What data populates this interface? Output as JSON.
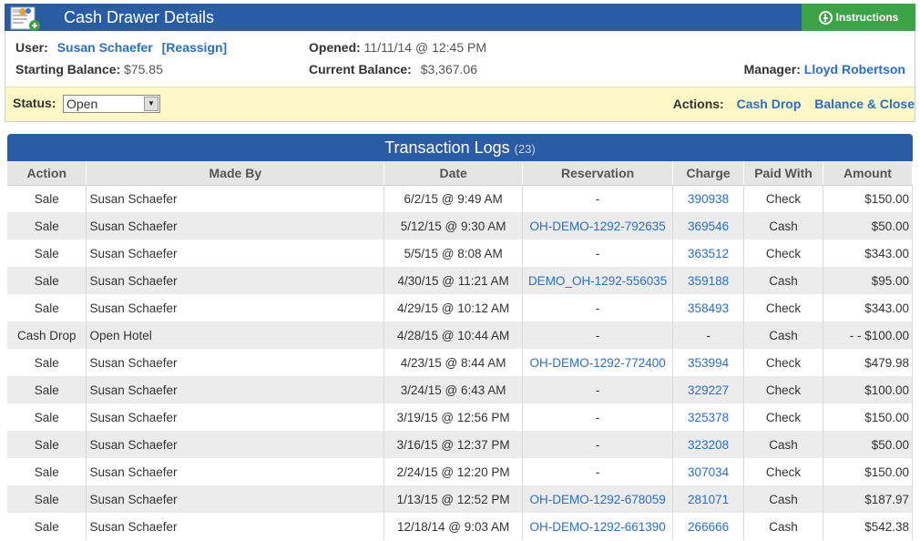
{
  "header": {
    "title": "Cash Drawer Details",
    "instructions_label": "Instructions"
  },
  "info": {
    "user_label": "User:",
    "user_name": "Susan Schaefer",
    "reassign_label": "[Reassign]",
    "opened_label": "Opened:",
    "opened_value": "11/11/14 @ 12:45 PM",
    "starting_balance_label": "Starting Balance:",
    "starting_balance_value": "$75.85",
    "current_balance_label": "Current Balance:",
    "current_balance_value": "$3,367.06",
    "manager_label": "Manager:",
    "manager_name": "Lloyd Robertson"
  },
  "status": {
    "label": "Status:",
    "selected": "Open",
    "actions_label": "Actions:",
    "cash_drop_label": "Cash Drop",
    "balance_close_label": "Balance & Close"
  },
  "transactions": {
    "title": "Transaction Logs",
    "count": "(23)",
    "columns": [
      "Action",
      "Made By",
      "Date",
      "Reservation",
      "Charge",
      "Paid With",
      "Amount"
    ],
    "rows": [
      {
        "action": "Sale",
        "made_by": "Susan Schaefer",
        "date": "6/2/15 @ 9:49 AM",
        "reservation": "-",
        "charge": "390938",
        "paid_with": "Check",
        "amount": "$150.00"
      },
      {
        "action": "Sale",
        "made_by": "Susan Schaefer",
        "date": "5/12/15 @ 9:30 AM",
        "reservation": "OH-DEMO-1292-792635",
        "charge": "369546",
        "paid_with": "Cash",
        "amount": "$50.00"
      },
      {
        "action": "Sale",
        "made_by": "Susan Schaefer",
        "date": "5/5/15 @ 8:08 AM",
        "reservation": "-",
        "charge": "363512",
        "paid_with": "Check",
        "amount": "$343.00"
      },
      {
        "action": "Sale",
        "made_by": "Susan Schaefer",
        "date": "4/30/15 @ 11:21 AM",
        "reservation": "DEMO_OH-1292-556035",
        "charge": "359188",
        "paid_with": "Cash",
        "amount": "$95.00"
      },
      {
        "action": "Sale",
        "made_by": "Susan Schaefer",
        "date": "4/29/15 @ 10:12 AM",
        "reservation": "-",
        "charge": "358493",
        "paid_with": "Check",
        "amount": "$343.00"
      },
      {
        "action": "Cash Drop",
        "made_by": "Open Hotel",
        "date": "4/28/15 @ 10:44 AM",
        "reservation": "-",
        "charge": "-",
        "paid_with": "Cash",
        "amount": "- - $100.00"
      },
      {
        "action": "Sale",
        "made_by": "Susan Schaefer",
        "date": "4/23/15 @ 8:44 AM",
        "reservation": "OH-DEMO-1292-772400",
        "charge": "353994",
        "paid_with": "Check",
        "amount": "$479.98"
      },
      {
        "action": "Sale",
        "made_by": "Susan Schaefer",
        "date": "3/24/15 @ 6:43 AM",
        "reservation": "-",
        "charge": "329227",
        "paid_with": "Check",
        "amount": "$100.00"
      },
      {
        "action": "Sale",
        "made_by": "Susan Schaefer",
        "date": "3/19/15 @ 12:56 PM",
        "reservation": "-",
        "charge": "325378",
        "paid_with": "Check",
        "amount": "$150.00"
      },
      {
        "action": "Sale",
        "made_by": "Susan Schaefer",
        "date": "3/16/15 @ 12:37 PM",
        "reservation": "-",
        "charge": "323208",
        "paid_with": "Cash",
        "amount": "$50.00"
      },
      {
        "action": "Sale",
        "made_by": "Susan Schaefer",
        "date": "2/24/15 @ 12:20 PM",
        "reservation": "-",
        "charge": "307034",
        "paid_with": "Check",
        "amount": "$150.00"
      },
      {
        "action": "Sale",
        "made_by": "Susan Schaefer",
        "date": "1/13/15 @ 12:52 PM",
        "reservation": "OH-DEMO-1292-678059",
        "charge": "281071",
        "paid_with": "Cash",
        "amount": "$187.97"
      },
      {
        "action": "Sale",
        "made_by": "Susan Schaefer",
        "date": "12/18/14 @ 9:03 AM",
        "reservation": "OH-DEMO-1292-661390",
        "charge": "266666",
        "paid_with": "Cash",
        "amount": "$542.38"
      }
    ]
  },
  "colors": {
    "header_blue": "#2a5ca5",
    "instructions_green": "#3aa447",
    "link_blue": "#2a6fc7",
    "status_bar_yellow": "#fbf8c5"
  },
  "icons": {
    "header": "cash-drawer-icon",
    "instructions": "plus-circle-icon",
    "select": "chevron-down-icon"
  }
}
